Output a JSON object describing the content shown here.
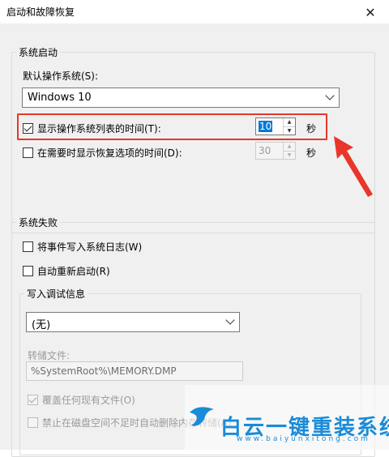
{
  "window": {
    "title": "启动和故障恢复",
    "close_glyph": "✕"
  },
  "system_startup": {
    "group_title": "系统启动",
    "default_os_label": "默认操作系统(S):",
    "default_os_value": "Windows 10",
    "show_os_list": {
      "label": "显示操作系统列表的时间(T):",
      "checked": true,
      "value": "10",
      "unit": "秒"
    },
    "show_recovery": {
      "label": "在需要时显示恢复选项的时间(D):",
      "checked": false,
      "value": "30",
      "unit": "秒"
    }
  },
  "system_failure": {
    "group_title": "系统失败",
    "write_event": {
      "label": "将事件写入系统日志(W)",
      "checked": false
    },
    "auto_restart": {
      "label": "自动重新启动(R)",
      "checked": false
    },
    "debug_info": {
      "group_title": "写入调试信息",
      "select_value": "(无)",
      "dump_file_label": "转储文件:",
      "dump_file_value": "%SystemRoot%\\MEMORY.DMP",
      "overwrite": {
        "label": "覆盖任何现有文件(O)",
        "checked": true
      },
      "disable_auto_delete": {
        "label": "禁止在磁盘空间不足时自动删除内存转储(A)",
        "checked": false
      }
    }
  },
  "annotation": {
    "color": "#e8362b"
  },
  "watermark": {
    "title": "白云一键重装系统",
    "subtitle": "www.baiyunxitong.com",
    "color": "#1a8bd8"
  }
}
